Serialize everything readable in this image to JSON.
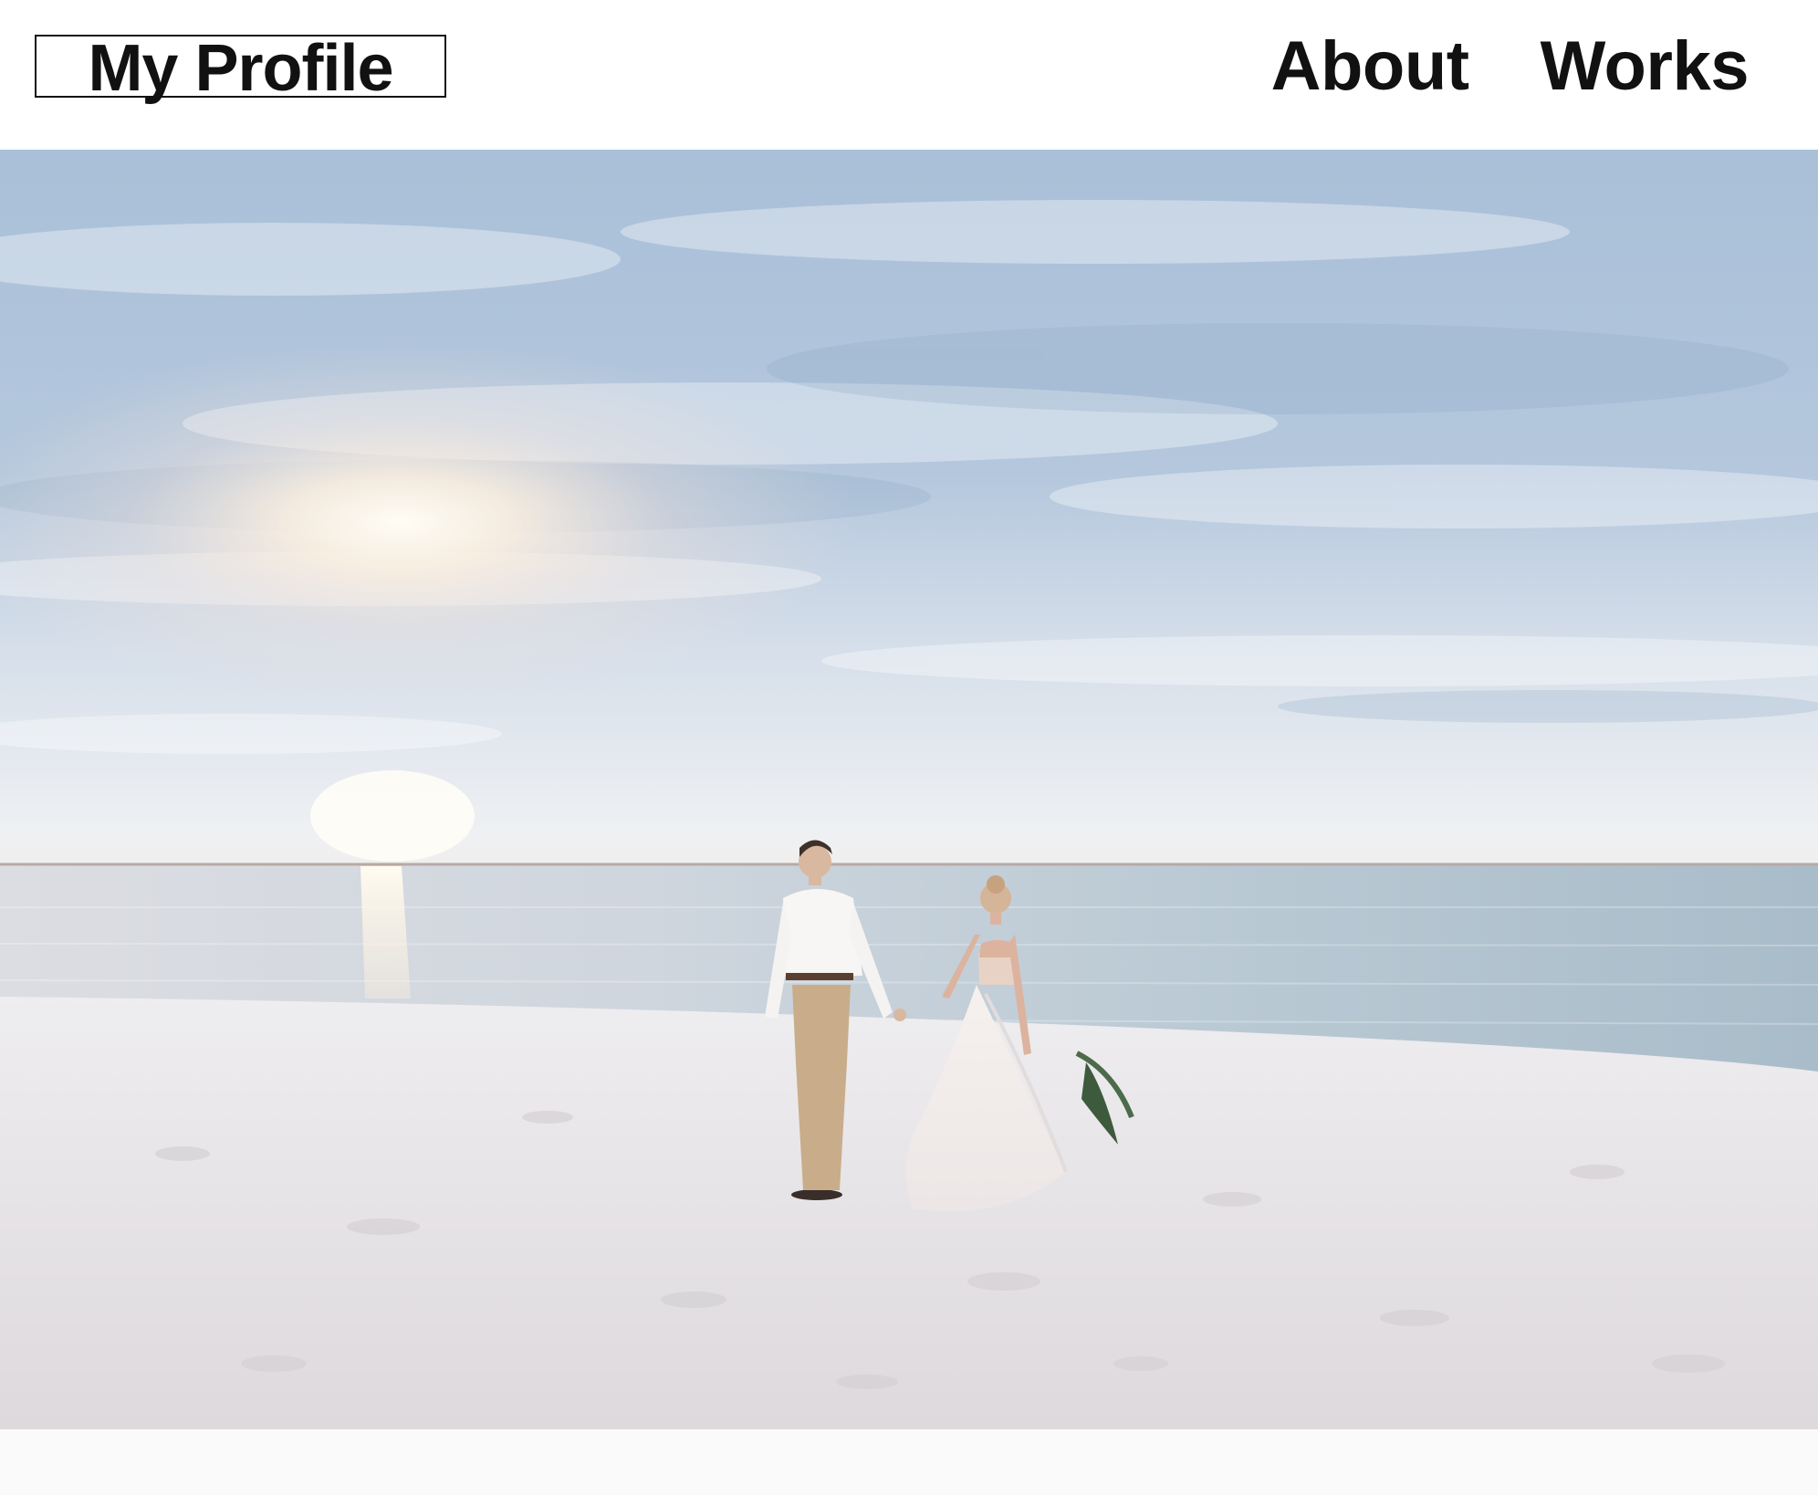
{
  "header": {
    "logo_text": "My Profile",
    "nav": [
      {
        "label": "About"
      },
      {
        "label": "Works"
      }
    ]
  },
  "hero": {
    "image": "wedding-couple-beach-sunset-photo"
  },
  "colors": {
    "text": "#111111",
    "background": "#ffffff"
  }
}
